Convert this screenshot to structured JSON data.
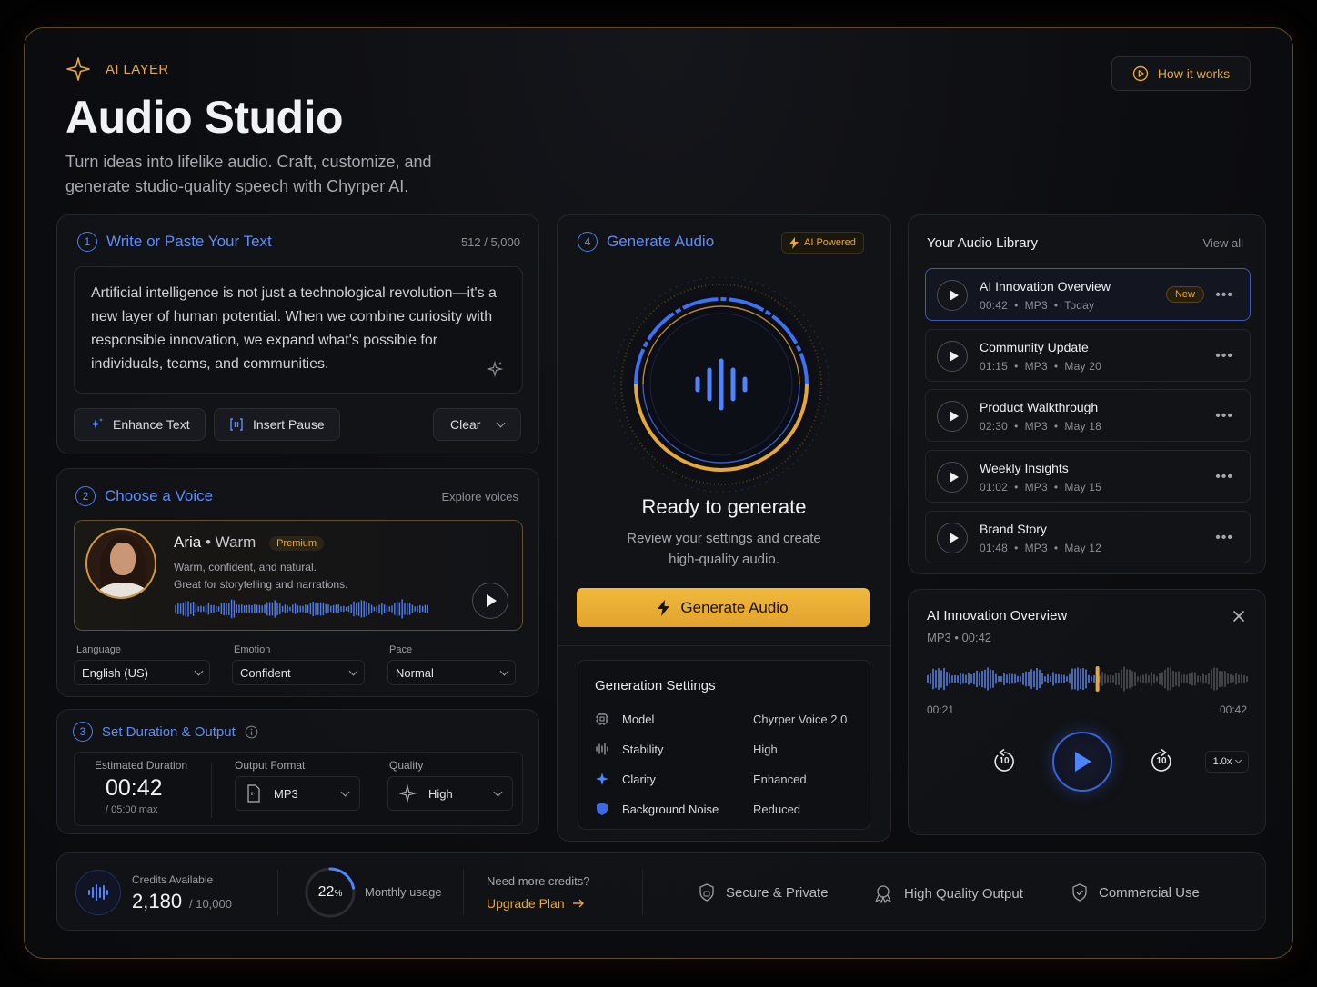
{
  "header": {
    "brand": "AI LAYER",
    "title": "Audio Studio",
    "subtitle": "Turn ideas into lifelike audio. Craft, customize, and generate studio-quality speech with Chyrper AI.",
    "how_it_works": "How it works"
  },
  "step1": {
    "number": "1",
    "title": "Write or Paste Your Text",
    "count": "512 / 5,000",
    "text": "Artificial intelligence is not just a technological revolution—it's a new layer of human potential. When we combine curiosity with responsible innovation, we expand what's possible for individuals, teams, and communities.",
    "enhance": "Enhance Text",
    "insert_pause": "Insert Pause",
    "clear": "Clear"
  },
  "step2": {
    "number": "2",
    "title": "Choose a Voice",
    "explore": "Explore voices",
    "voice_name": "Aria",
    "voice_style": "• Warm",
    "badge": "Premium",
    "desc1": "Warm, confident, and natural.",
    "desc2": "Great for storytelling and narrations.",
    "language_label": "Language",
    "language": "English (US)",
    "emotion_label": "Emotion",
    "emotion": "Confident",
    "pace_label": "Pace",
    "pace": "Normal"
  },
  "step3": {
    "number": "3",
    "title": "Set Duration & Output",
    "duration_label": "Estimated Duration",
    "duration": "00:42",
    "duration_max": "/ 05:00 max",
    "format_label": "Output Format",
    "format": "MP3",
    "quality_label": "Quality",
    "quality": "High"
  },
  "step4": {
    "number": "4",
    "title": "Generate Audio",
    "badge": "AI Powered",
    "ready": "Ready to generate",
    "ready_desc1": "Review your settings and create",
    "ready_desc2": "high-quality audio.",
    "button": "Generate Audio",
    "settings_title": "Generation Settings",
    "settings": [
      {
        "label": "Model",
        "value": "Chyrper Voice 2.0"
      },
      {
        "label": "Stability",
        "value": "High"
      },
      {
        "label": "Clarity",
        "value": "Enhanced"
      },
      {
        "label": "Background Noise",
        "value": "Reduced"
      }
    ]
  },
  "library": {
    "title": "Your Audio Library",
    "view_all": "View all",
    "new_badge": "New",
    "items": [
      {
        "title": "AI Innovation Overview",
        "duration": "00:42",
        "format": "MP3",
        "date": "Today"
      },
      {
        "title": "Community Update",
        "duration": "01:15",
        "format": "MP3",
        "date": "May 20"
      },
      {
        "title": "Product Walkthrough",
        "duration": "02:30",
        "format": "MP3",
        "date": "May 18"
      },
      {
        "title": "Weekly Insights",
        "duration": "01:02",
        "format": "MP3",
        "date": "May 15"
      },
      {
        "title": "Brand Story",
        "duration": "01:48",
        "format": "MP3",
        "date": "May 12"
      }
    ]
  },
  "player": {
    "title": "AI Innovation Overview",
    "meta": "MP3 • 00:42",
    "current": "00:21",
    "total": "00:42",
    "progress": 0.53,
    "skip": "10",
    "speed": "1.0x"
  },
  "footer": {
    "credits_label": "Credits Available",
    "credits": "2,180",
    "credits_total": "/ 10,000",
    "usage_value": "22",
    "usage_unit": "%",
    "usage_label": "Monthly usage",
    "more_credits": "Need more credits?",
    "upgrade": "Upgrade Plan",
    "features": [
      "Secure & Private",
      "High Quality Output",
      "Commercial Use"
    ]
  },
  "colors": {
    "accent_gold": "#e6a83a",
    "accent_blue": "#5f8cf5",
    "bg": "#0c0d10"
  }
}
